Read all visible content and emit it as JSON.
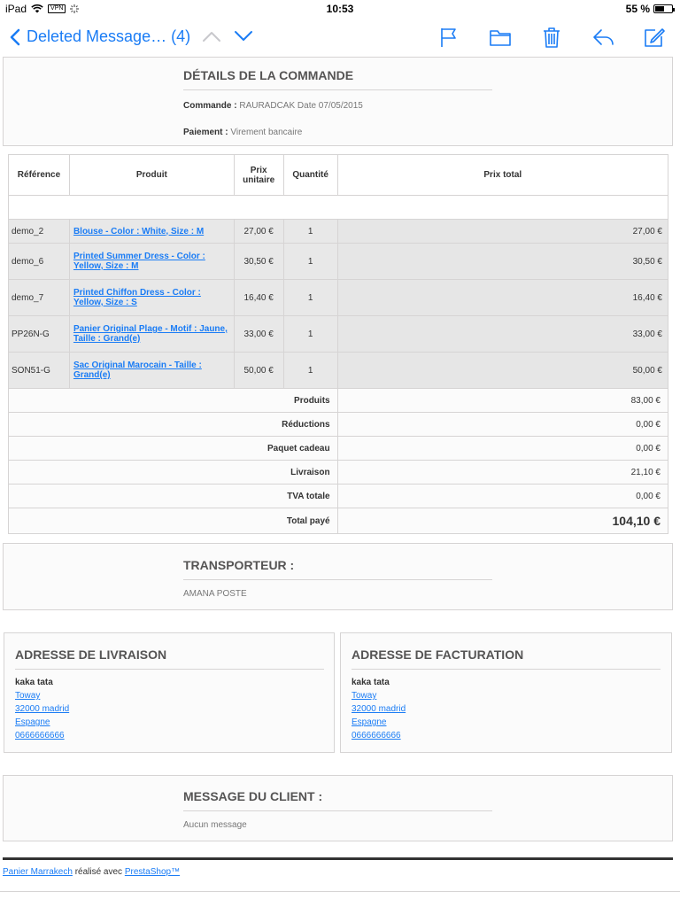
{
  "status": {
    "device": "iPad",
    "vpn": "VPN",
    "time": "10:53",
    "battery": "55 %",
    "battery_level_pct": 55
  },
  "nav": {
    "back_label": "Deleted Message… (4)",
    "icons": [
      "chevron-left-icon",
      "chevron-up-icon",
      "chevron-down-icon",
      "flag-icon",
      "folder-icon",
      "trash-icon",
      "reply-icon",
      "compose-icon"
    ]
  },
  "order": {
    "title": "DÉTAILS DE LA COMMANDE",
    "command_label": "Commande :",
    "command_value": "RAURADCAK Date 07/05/2015",
    "payment_label": "Paiement :",
    "payment_value": "Virement bancaire"
  },
  "table": {
    "headers": {
      "ref": "Référence",
      "product": "Produit",
      "unit_price_1": "Prix",
      "unit_price_2": "unitaire",
      "qty": "Quantité",
      "total": "Prix total"
    },
    "rows": [
      {
        "ref": "demo_2",
        "product": "Blouse - Color : White, Size : M",
        "price": "27,00 €",
        "qty": "1",
        "total": "27,00 €"
      },
      {
        "ref": "demo_6",
        "product": "Printed Summer Dress - Color : Yellow, Size : M",
        "price": "30,50 €",
        "qty": "1",
        "total": "30,50 €"
      },
      {
        "ref": "demo_7",
        "product": "Printed Chiffon Dress - Color : Yellow, Size : S",
        "price": "16,40 €",
        "qty": "1",
        "total": "16,40 €"
      },
      {
        "ref": "PP26N-G",
        "product": "Panier Original Plage - Motif : Jaune, Taille : Grand(e)",
        "price": "33,00 €",
        "qty": "1",
        "total": "33,00 €"
      },
      {
        "ref": "SON51-G",
        "product": "Sac Original Marocain - Taille : Grand(e)",
        "price": "50,00 €",
        "qty": "1",
        "total": "50,00 €"
      }
    ],
    "summary": [
      {
        "label": "Produits",
        "value": "83,00 €"
      },
      {
        "label": "Réductions",
        "value": "0,00 €"
      },
      {
        "label": "Paquet cadeau",
        "value": "0,00 €"
      },
      {
        "label": "Livraison",
        "value": "21,10 €"
      },
      {
        "label": "TVA totale",
        "value": "0,00 €"
      },
      {
        "label": "Total payé",
        "value": "104,10 €"
      }
    ]
  },
  "carrier": {
    "title": "TRANSPORTEUR :",
    "value": "AMANA POSTE"
  },
  "shipping": {
    "title": "ADRESSE DE LIVRAISON",
    "name": "kaka tata",
    "lines": [
      "Toway",
      "32000 madrid",
      "Espagne",
      "0666666666"
    ]
  },
  "billing": {
    "title": "ADRESSE DE FACTURATION",
    "name": "kaka tata",
    "lines": [
      "Toway",
      "32000 madrid",
      "Espagne",
      "0666666666"
    ]
  },
  "message": {
    "title": "MESSAGE DU CLIENT :",
    "value": "Aucun message"
  },
  "footer": {
    "shop_link": "Panier Marrakech",
    "middle": " réalisé avec ",
    "ps_link": "PrestaShop™"
  },
  "colors": {
    "accent": "#1a7cf5",
    "row_bg": "#e8e8e8",
    "panel_bg": "#fbfbfb",
    "border": "#d6d4d4"
  }
}
